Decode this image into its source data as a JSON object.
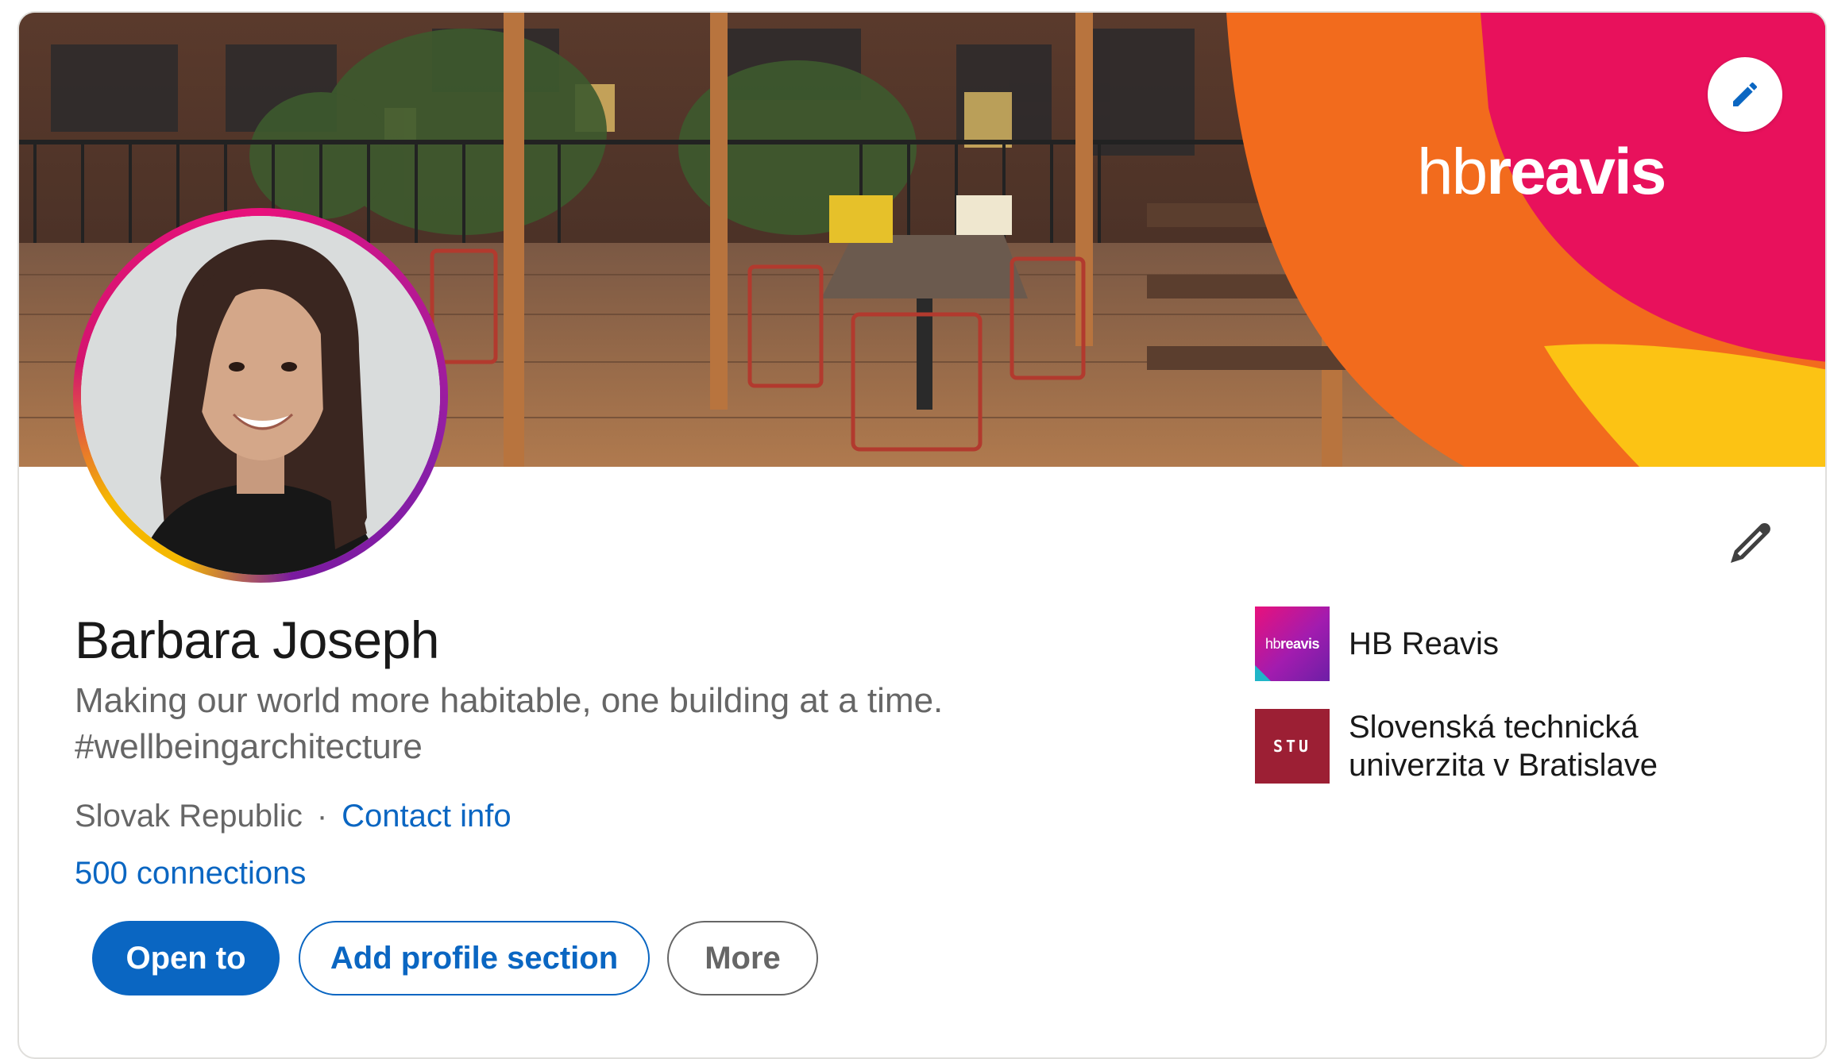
{
  "banner": {
    "brand_logo_light": "hb",
    "brand_logo_bold": "reavis",
    "edit_icon": "pencil-icon"
  },
  "profile": {
    "name": "Barbara Joseph",
    "headline": "Making our world more habitable, one building at a time. #wellbeingarchitecture",
    "location": "Slovak Republic",
    "separator": "·",
    "contact_info": "Contact info",
    "connections": "500 connections",
    "edit_icon": "pencil-icon"
  },
  "actions": {
    "open_to": "Open to",
    "add_section": "Add profile section",
    "more": "More"
  },
  "organizations": [
    {
      "name": "HB Reavis",
      "logo_text_light": "hb",
      "logo_text_bold": "reavis"
    },
    {
      "name": "Slovenská technická univerzita v Bratislave",
      "logo_text": "STU"
    }
  ],
  "colors": {
    "accent": "#0a66c2",
    "ring_pink": "#e8117c",
    "ring_purple": "#8a1fa8",
    "ring_yellow": "#f5b800",
    "brand_orange": "#f26b1d"
  }
}
